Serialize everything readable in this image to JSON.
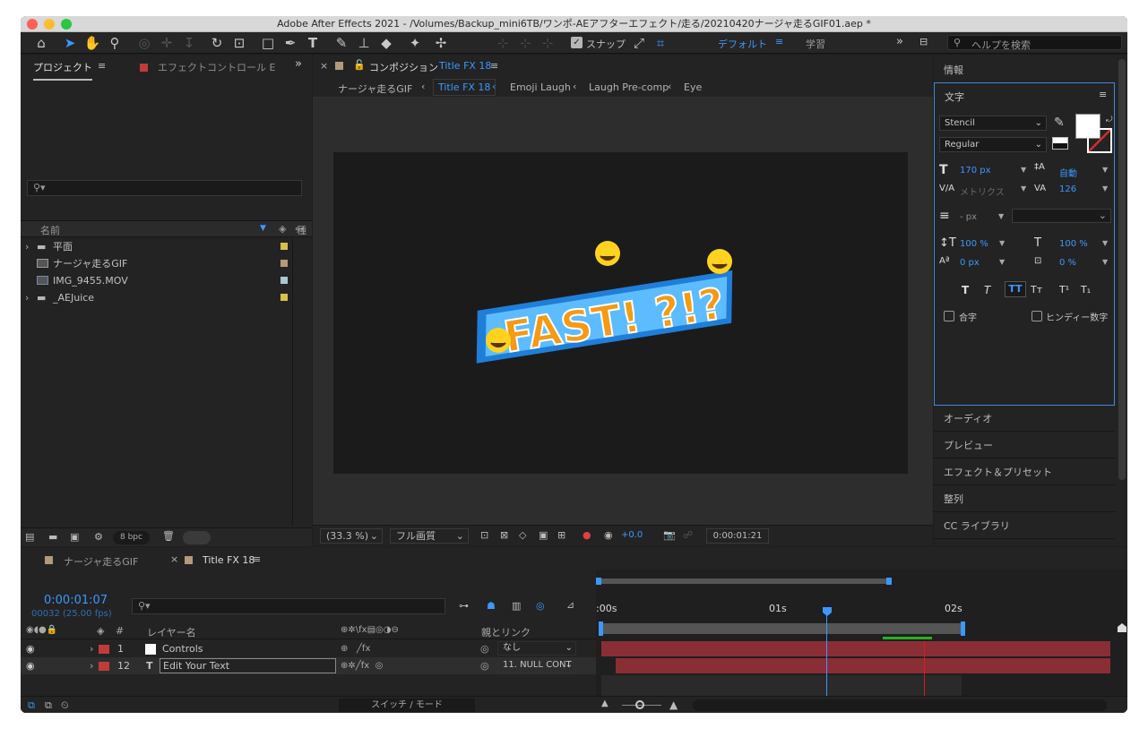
{
  "window": {
    "title": "Adobe After Effects 2021 - /Volumes/Backup_mini6TB/ワンポ-AEアフターエフェクト/走る/20210420ナージャ走るGIF01.aep *"
  },
  "toolbar": {
    "snap_label": "スナップ",
    "workspace_default": "デフォルト",
    "workspace_learn": "学習",
    "search_placeholder": "ヘルプを検索"
  },
  "project": {
    "tab_label": "プロジェクト",
    "effect_tab_label": "エフェクトコントロール E",
    "col_name": "名前",
    "col_type": "種",
    "items": [
      {
        "name": "平面",
        "swatch": "#d6c24a"
      },
      {
        "name": "ナージャ走るGIF",
        "swatch": "#b29a7a"
      },
      {
        "name": "IMG_9455.MOV",
        "swatch": "#a9c9cf"
      },
      {
        "name": "_AEJuice",
        "swatch": "#d6c24a"
      }
    ],
    "bpc": "8 bpc"
  },
  "composition": {
    "tab_prefix": "コンポジション",
    "tab_name": "Title FX 18",
    "breadcrumbs": [
      "ナージャ走るGIF",
      "Title FX 18",
      "Emoji Laugh",
      "Laugh Pre-comp",
      "Eye"
    ],
    "zoom": "(33.3 %)",
    "quality": "フル画質",
    "exposure": "+0.0",
    "timecode": "0:00:01:21",
    "artwork_text": "FAST! ?!?"
  },
  "right_panel": {
    "info_label": "情報",
    "char_label": "文字",
    "font_family": "Stencil",
    "font_style": "Regular",
    "font_size": "170 px",
    "leading": "自動",
    "kerning": "メトリクス",
    "tracking": "126",
    "stroke": "- px",
    "v_scale": "100 %",
    "h_scale": "100 %",
    "baseline": "0 px",
    "tsume": "0 %",
    "ligature_label": "合字",
    "hindi_label": "ヒンディー数字",
    "collapsed": [
      "オーディオ",
      "プレビュー",
      "エフェクト＆プリセット",
      "整列",
      "CC ライブラリ"
    ]
  },
  "timeline": {
    "tab1": "ナージャ走るGIF",
    "tab2": "Title FX 18",
    "timecode": "0:00:01:07",
    "frames": "00032 (25.00 fps)",
    "col_layer_name": "レイヤー名",
    "col_parent": "親とリンク",
    "ruler": [
      ":00s",
      "01s",
      "02s"
    ],
    "layers": [
      {
        "num": "1",
        "name": "Controls",
        "parent": "なし",
        "color": "#c23b3b"
      },
      {
        "num": "12",
        "name": "Edit Your Text",
        "parent": "11. NULL CONT",
        "color": "#c23b3b"
      }
    ],
    "switch_mode": "スイッチ / モード"
  }
}
